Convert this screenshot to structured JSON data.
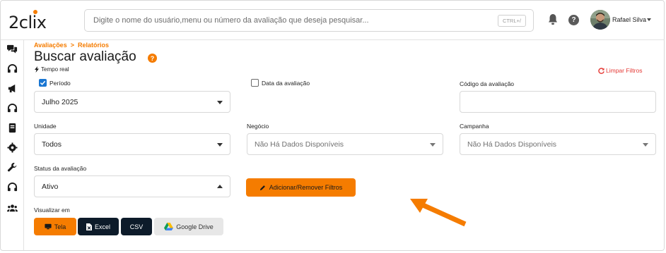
{
  "app": {
    "logo_text": "2clix",
    "search_placeholder": "Digite o nome do usuário,menu ou número da avaliação que deseja pesquisar...",
    "search_shortcut": "CTRL+/",
    "help_glyph": "?",
    "user_name": "Rafael Silva"
  },
  "sidebar": {
    "icons": [
      "chat-bubbles-icon",
      "headset-icon",
      "megaphone-icon",
      "headset-icon",
      "book-icon",
      "gear-icon",
      "wrench-icon",
      "headset-icon",
      "users-icon"
    ]
  },
  "breadcrumb": {
    "items": [
      "Avaliações",
      "Relatórios"
    ],
    "separator": ">"
  },
  "page": {
    "title": "Buscar avaliação",
    "realtime_label": "Tempo real",
    "clear_filters_label": "Limpar Filtros"
  },
  "filters": {
    "period": {
      "label": "Período",
      "checked": true,
      "value": "Julho 2025"
    },
    "date": {
      "label": "Data da avaliação",
      "checked": false
    },
    "code": {
      "label": "Código da avaliação",
      "value": ""
    },
    "unit": {
      "label": "Unidade",
      "value": "Todos"
    },
    "business": {
      "label": "Negócio",
      "value": "Não Há Dados Disponíveis"
    },
    "campaign": {
      "label": "Campanha",
      "value": "Não Há Dados Disponíveis"
    },
    "status": {
      "label": "Status da avaliação",
      "value": "Ativo"
    },
    "add_remove_label": "Adicionar/Remover Filtros"
  },
  "view": {
    "label": "Visualizar em",
    "buttons": {
      "tela": "Tela",
      "excel": "Excel",
      "csv": "CSV",
      "drive": "Google Drive"
    }
  },
  "colors": {
    "accent": "#f57c00",
    "dark_button": "#0d1b2a",
    "check_blue": "#1976d2",
    "clear_red": "#e53935"
  }
}
